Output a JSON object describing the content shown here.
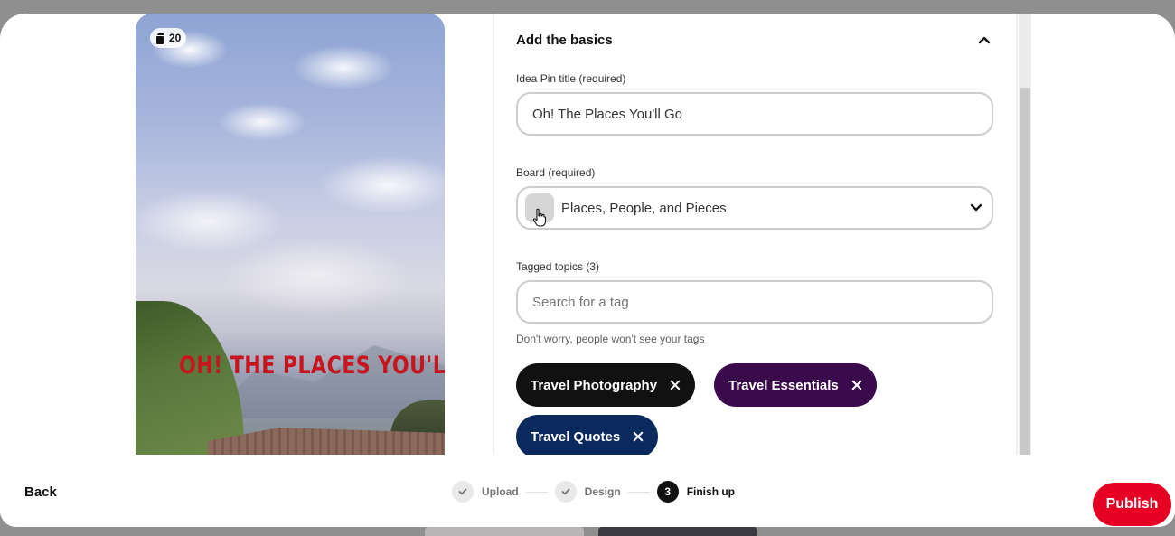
{
  "preview": {
    "page_count": "20",
    "overlay_text": "OH! THE PLACES YOU'LL GO"
  },
  "basics": {
    "section_title": "Add the basics",
    "title_label": "Idea Pin title (required)",
    "title_value": "Oh! The Places You'll Go",
    "board_label": "Board (required)",
    "board_value": "Places, People, and Pieces",
    "topics_label": "Tagged topics (3)",
    "topics_placeholder": "Search for a tag",
    "helper_text": "Don't worry, people won't see your tags",
    "tags": [
      {
        "label": "Travel Photography",
        "color": "#111111"
      },
      {
        "label": "Travel Essentials",
        "color": "#3b0a4d"
      },
      {
        "label": "Travel Quotes",
        "color": "#0a2a5e"
      }
    ]
  },
  "footer": {
    "back_label": "Back",
    "steps": [
      {
        "label": "Upload",
        "state": "done"
      },
      {
        "label": "Design",
        "state": "done"
      },
      {
        "label": "Finish up",
        "state": "current",
        "number": "3"
      }
    ],
    "publish_label": "Publish"
  },
  "colors": {
    "accent": "#e60023"
  }
}
